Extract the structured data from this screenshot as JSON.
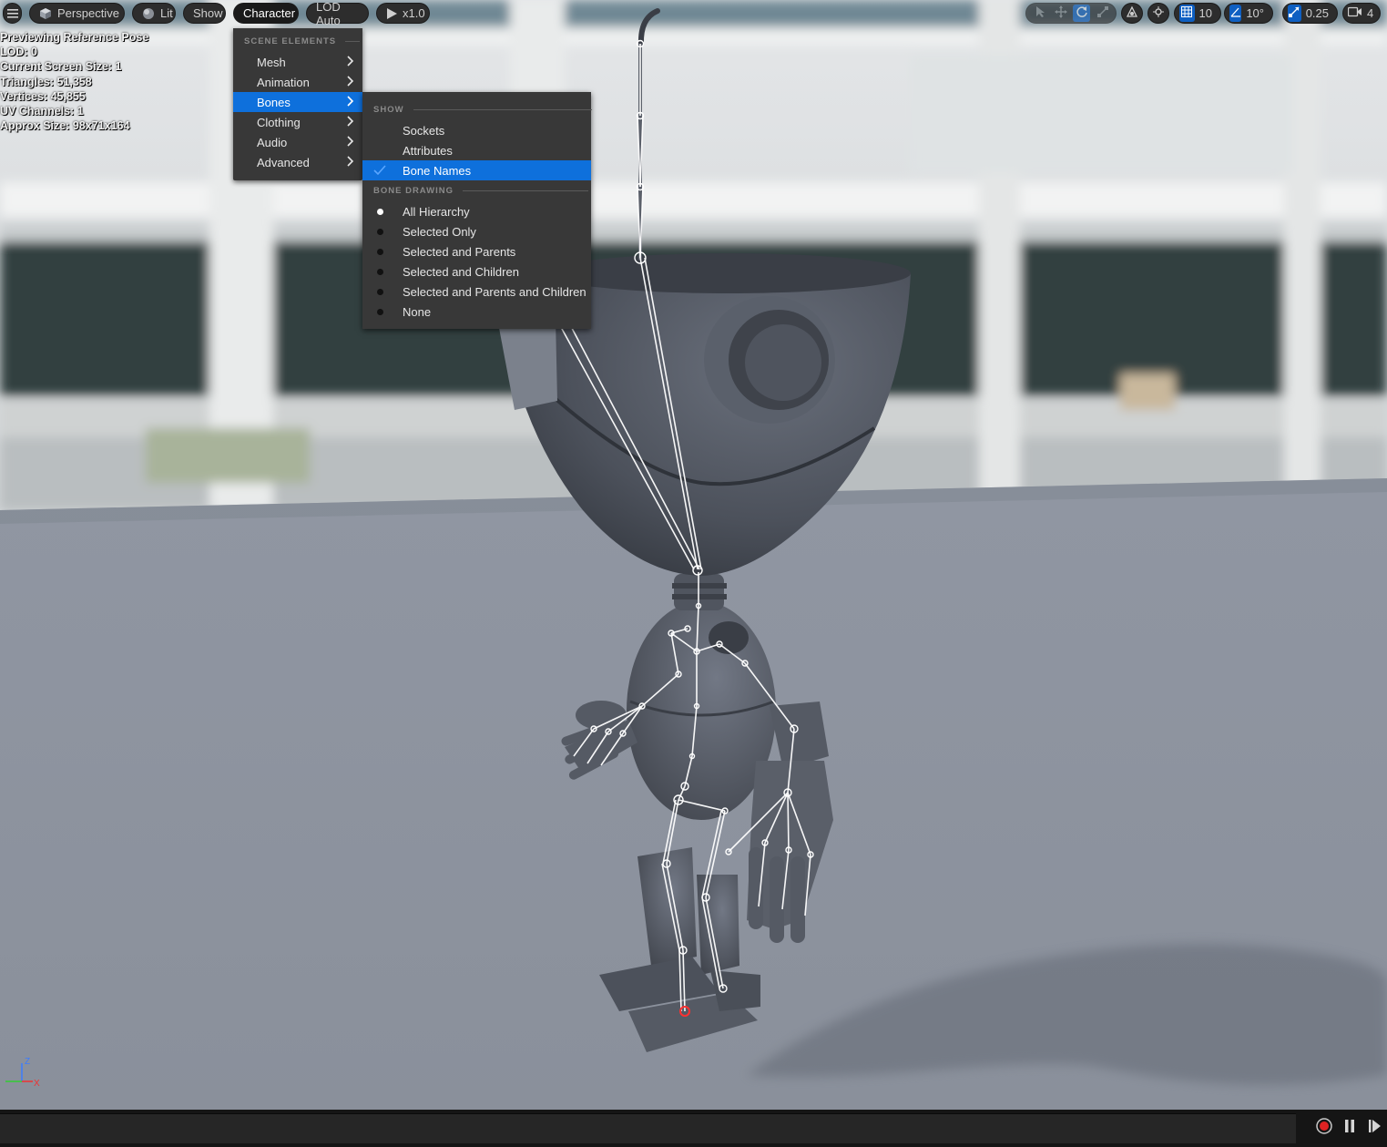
{
  "toolbar": {
    "menu_icon": "hamburger-icon",
    "perspective_label": "Perspective",
    "lit_label": "Lit",
    "show_label": "Show",
    "character_label": "Character",
    "lod_label": "LOD Auto",
    "play_speed_label": "x1.0",
    "grid_snap_value": "10",
    "rotation_snap_value": "10°",
    "scale_snap_value": "0.25",
    "camera_speed_value": "4",
    "accent_color": "#0e70dc"
  },
  "stats": {
    "line1": "Previewing Reference Pose",
    "line2": "LOD: 0",
    "line3": "Current Screen Size: 1",
    "line4": "Triangles: 51,358",
    "line5": "Vertices: 45,855",
    "line6": "UV Channels: 1",
    "line7": "Approx Size: 98x71x164"
  },
  "character_menu": {
    "section": "SCENE ELEMENTS",
    "items": [
      {
        "label": "Mesh"
      },
      {
        "label": "Animation"
      },
      {
        "label": "Bones"
      },
      {
        "label": "Clothing"
      },
      {
        "label": "Audio"
      },
      {
        "label": "Advanced"
      }
    ],
    "selected": "Bones"
  },
  "bones_menu": {
    "show_section": "SHOW",
    "show_items": [
      {
        "label": "Sockets",
        "checked": false
      },
      {
        "label": "Attributes",
        "checked": false
      },
      {
        "label": "Bone Names",
        "checked": true
      }
    ],
    "drawing_section": "BONE DRAWING",
    "drawing_items": [
      {
        "label": "All Hierarchy",
        "selected": true
      },
      {
        "label": "Selected Only",
        "selected": false
      },
      {
        "label": "Selected and Parents",
        "selected": false
      },
      {
        "label": "Selected and Children",
        "selected": false
      },
      {
        "label": "Selected and Parents and Children",
        "selected": false
      },
      {
        "label": "None",
        "selected": false
      }
    ]
  },
  "axis": {
    "z": "Z",
    "x": "X"
  }
}
